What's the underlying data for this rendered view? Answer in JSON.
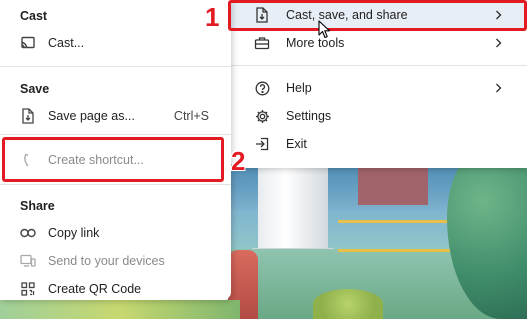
{
  "submenu": {
    "sections": {
      "cast": {
        "title": "Cast",
        "items": [
          {
            "label": "Cast...",
            "icon": "cast-icon",
            "disabled": false
          }
        ]
      },
      "save": {
        "title": "Save",
        "items": [
          {
            "label": "Save page as...",
            "shortcut": "Ctrl+S",
            "icon": "save-page-icon",
            "disabled": false
          },
          {
            "label": "Create shortcut...",
            "icon": "create-shortcut-icon",
            "disabled": true
          }
        ]
      },
      "share": {
        "title": "Share",
        "items": [
          {
            "label": "Copy link",
            "icon": "link-icon",
            "disabled": false
          },
          {
            "label": "Send to your devices",
            "icon": "devices-icon",
            "disabled": true
          },
          {
            "label": "Create QR Code",
            "icon": "qr-code-icon",
            "disabled": false
          }
        ]
      }
    }
  },
  "main_menu": {
    "items": [
      {
        "label": "Cast, save, and share",
        "icon": "cast-save-share-icon",
        "has_submenu": true,
        "active": true
      },
      {
        "label": "More tools",
        "icon": "toolbox-icon",
        "has_submenu": true
      },
      {
        "label": "Help",
        "icon": "help-icon",
        "has_submenu": true
      },
      {
        "label": "Settings",
        "icon": "gear-icon",
        "has_submenu": false
      },
      {
        "label": "Exit",
        "icon": "exit-icon",
        "has_submenu": false
      }
    ]
  },
  "annotations": {
    "one": "1",
    "two": "2",
    "color": "#e21b23"
  },
  "colors": {
    "active_row": "#e8eef6",
    "disabled_text": "#8a8a8a"
  }
}
